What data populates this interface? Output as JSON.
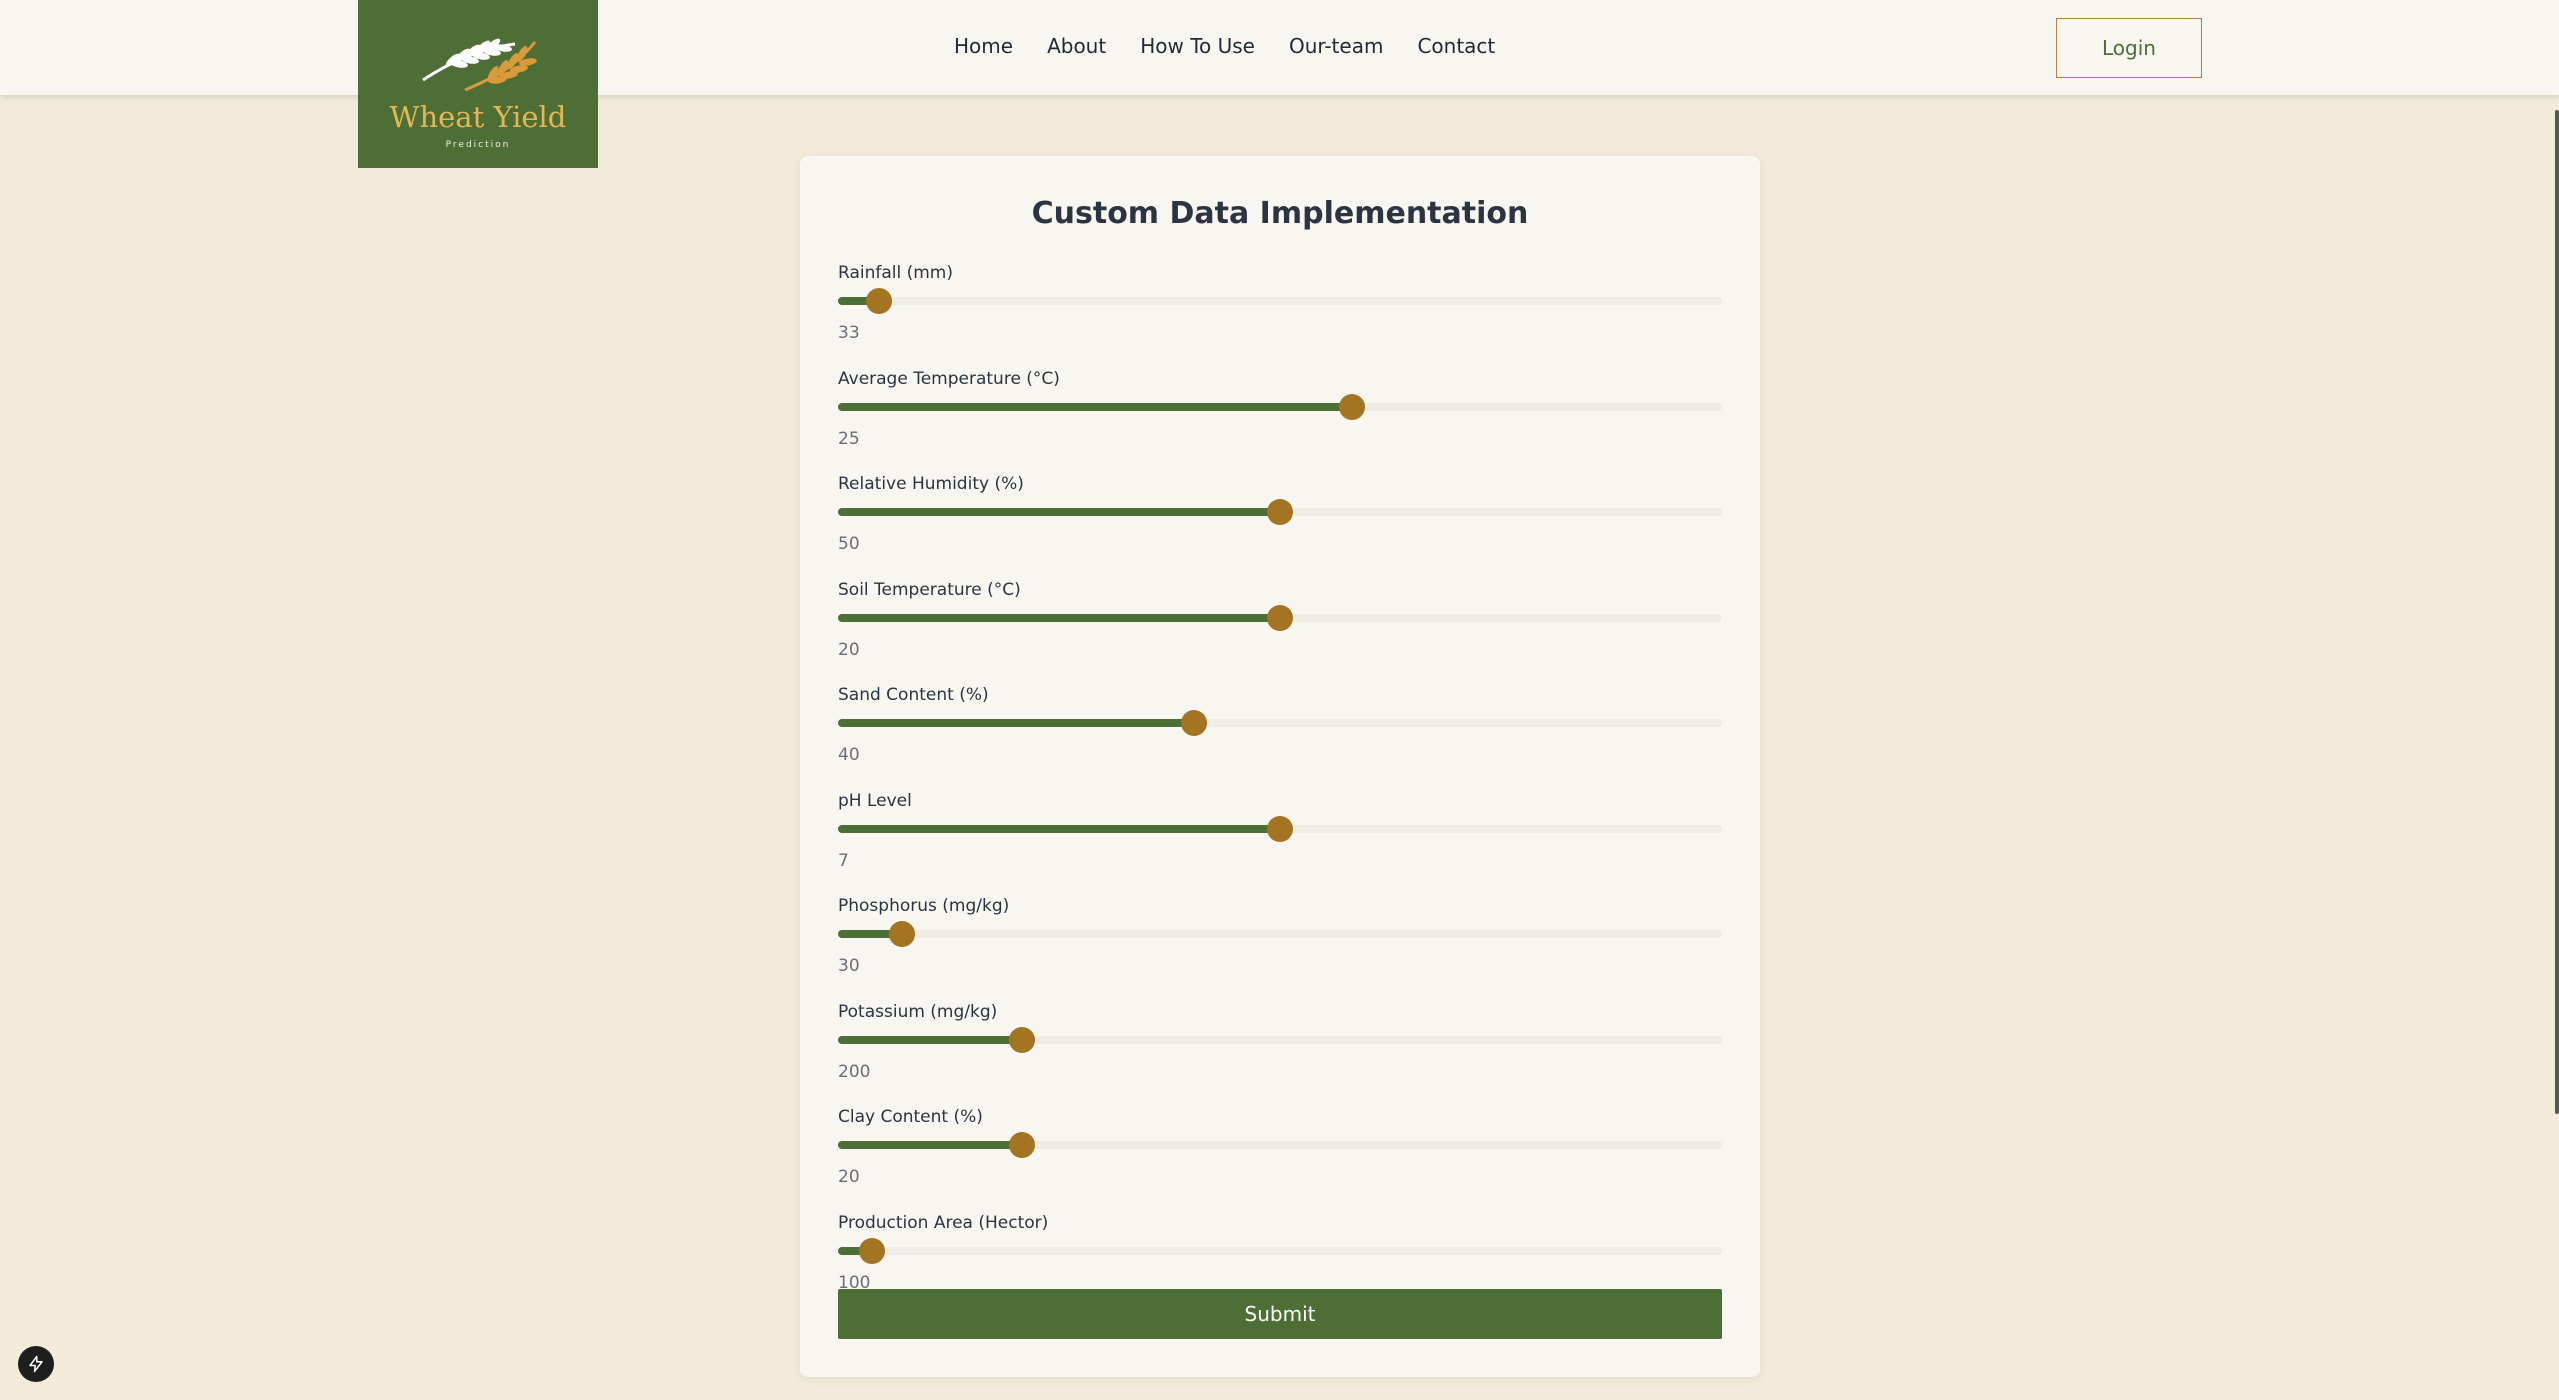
{
  "brand": {
    "title": "Wheat Yield",
    "subtitle": "Prediction",
    "logo_bg": "#4d6e35",
    "title_color": "#e6b654"
  },
  "nav": {
    "links": [
      "Home",
      "About",
      "How To Use",
      "Our-team",
      "Contact"
    ],
    "login_label": "Login"
  },
  "form": {
    "title": "Custom Data Implementation",
    "fields": [
      {
        "label": "Rainfall (mm)",
        "value": "33",
        "fraction": 0.046
      },
      {
        "label": "Average Temperature (°C)",
        "value": "25",
        "fraction": 0.581
      },
      {
        "label": "Relative Humidity (%)",
        "value": "50",
        "fraction": 0.5
      },
      {
        "label": "Soil Temperature (°C)",
        "value": "20",
        "fraction": 0.5
      },
      {
        "label": "Sand Content (%)",
        "value": "40",
        "fraction": 0.403
      },
      {
        "label": "pH Level",
        "value": "7",
        "fraction": 0.5
      },
      {
        "label": "Phosphorus (mg/kg)",
        "value": "30",
        "fraction": 0.072
      },
      {
        "label": "Potassium (mg/kg)",
        "value": "200",
        "fraction": 0.208
      },
      {
        "label": "Clay Content (%)",
        "value": "20",
        "fraction": 0.208
      },
      {
        "label": "Production Area (Hector)",
        "value": "100",
        "fraction": 0.038
      }
    ],
    "submit_label": "Submit"
  },
  "colors": {
    "accent_green": "#4d6e35",
    "thumb_gold": "#a37421",
    "page_bg": "#f2ebda"
  },
  "icons": {
    "logo": "wheat-ear-icon",
    "floating": "lightning-bolt-icon"
  }
}
